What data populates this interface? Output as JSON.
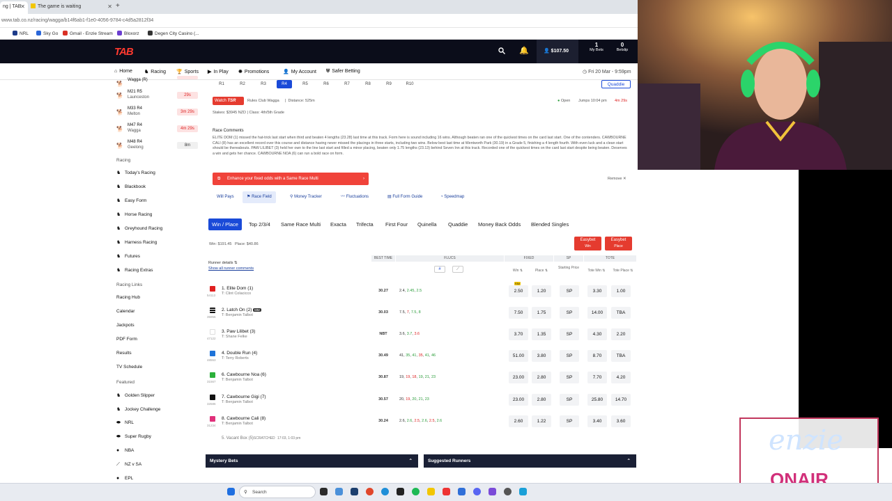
{
  "browser": {
    "tabs": [
      {
        "label": "ng | TAB",
        "active": true
      },
      {
        "label": "The game is waiting",
        "active": false
      }
    ],
    "new_tab": "+",
    "url": "www.tab.co.nz/racing/wagga/b14f6ab1-f1e0-4056-9784-c4d5a2812f34",
    "bookmarks": [
      "NRL",
      "Sky Go",
      "Gmail - Enzie Stream",
      "Bloxorz",
      "Degen City Casino (..."
    ]
  },
  "header": {
    "logo": "TAB",
    "balance": "$107.50",
    "my_bets_count": "1",
    "my_bets_label": "My Bets",
    "betslip_count": "0",
    "betslip_label": "Betslip"
  },
  "nav": {
    "items": [
      "Home",
      "Racing",
      "Sports",
      "In Play",
      "Promotions",
      "My Account",
      "Safer Betting"
    ],
    "datetime": "Fri 20 Mar - 9:59pm"
  },
  "sidebar": {
    "races": [
      {
        "code": "Wagga (R)",
        "venue": "",
        "time": ""
      },
      {
        "code": "M21 R5",
        "venue": "Launceston",
        "time": "29s"
      },
      {
        "code": "M33 R4",
        "venue": "Melton",
        "time": "3m 29s"
      },
      {
        "code": "M47 R4",
        "venue": "Wagga",
        "time": "4m 29s"
      },
      {
        "code": "M48 R4",
        "venue": "Geelong",
        "time": "8m"
      }
    ],
    "racing_title": "Racing",
    "racing_links": [
      "Today's Racing",
      "Blackbook",
      "Easy Form",
      "Horse Racing",
      "Greyhound Racing",
      "Harness Racing",
      "Futures",
      "Racing Extras"
    ],
    "racing_links_title": "Racing Links",
    "link_items": [
      "Racing Hub",
      "Calendar",
      "Jackpots",
      "PDF Form",
      "Results",
      "TV Schedule"
    ],
    "featured_title": "Featured",
    "featured": [
      "Golden Slipper",
      "Jockey Challenge",
      "NRL",
      "Super Rugby",
      "NBA",
      "NZ v SA",
      "EPL"
    ]
  },
  "race": {
    "race_buttons": [
      "R1",
      "R2",
      "R3",
      "R4",
      "R5",
      "R6",
      "R7",
      "R8",
      "R9",
      "R10"
    ],
    "selected_race": "R4",
    "quaddie": "Quaddie",
    "watch": "Watch",
    "watch_brand": "TSR",
    "club": "Rules Club Wagga",
    "distance": "Distance: 525m",
    "stakes": "Stakes: $3945 NZD  |  Class: 4th/5th Grade",
    "status": "Open",
    "jumps": "Jumps 10:04 pm",
    "countdown": "4m 29s",
    "comments_title": "Race Comments",
    "comments": "ELITE DOM (1) missed the hat-trick last start when third and beaten 4 lengths (23.28) last time at this track. Form here is sound including 16 wins. Although beaten ran one of the quickest times on the card last start. One of the contenders. CAWBOURNE CALI (8) has an excellent record over this course and distance having never missed the placings in three starts, including two wins. Below best last time at Wentworth Park (30.19) in a Grade 5, finishing a 4 length fourth. With even luck and a clean start should be thereabouts. PAW LILIBET (3) held her own to the line last start and filled a minor placing, beaten only 1.75 lengths (23.13) behind Seven Inn at this track. Recorded one of the quickest times on the card last start despite being beaten. Deserves a win and gets her chance. CAWBOURNE NOA (6) can run a bold race on form.",
    "promo": "Enhance your fixed odds with a Same Race Multi",
    "remove": "Remove",
    "tools": [
      "Will Pays",
      "Race Field",
      "Money Tracker",
      "Fluctuations",
      "Full Form Guide",
      "Speedmap"
    ],
    "bet_tabs": [
      "Win / Place",
      "Top 2/3/4",
      "Same Race Multi",
      "Exacta",
      "Trifecta",
      "First Four",
      "Quinella",
      "Quaddie",
      "Money Back Odds",
      "Blended Singles"
    ],
    "pool": "Win: $191.45   Place: $40.86",
    "easybet_win": [
      "Easybet",
      "Win"
    ],
    "easybet_place": [
      "Easybet",
      "Place"
    ]
  },
  "table": {
    "runner_details": "Runner details",
    "show_comments": "Show all runner comments",
    "best_time": "BEST TIME",
    "flucs": "FLUCS",
    "fixed": "FIXED",
    "sp": "SP",
    "tote": "TOTE",
    "col_win": "Win",
    "col_place": "Place",
    "col_sp": "Starting Price",
    "col_tote_win": "Tote Win",
    "col_tote_place": "Tote Place",
    "fav_badge": "FAV",
    "runners": [
      {
        "name": "1. Elite Dom (1)",
        "trainer": "T: Clint Colacicco",
        "id": "54113",
        "color": "#e02020",
        "best": "30.27",
        "flucs": [
          [
            "2.4",
            "n"
          ],
          [
            "2.45",
            "g"
          ],
          [
            "2.5",
            "g"
          ]
        ],
        "win": "2.50",
        "place": "1.20",
        "sp": "SP",
        "tote_win": "3.30",
        "tote_place": "1.00"
      },
      {
        "name": "2. Latch On (2)",
        "trainer": "T: Benjamin Talbot",
        "id": "35956",
        "color": "stripes",
        "best": "30.03",
        "flucs": [
          [
            "7.5",
            "n"
          ],
          [
            "7",
            "r"
          ],
          [
            "7.5",
            "g"
          ],
          [
            "8",
            "g"
          ]
        ],
        "win": "7.50",
        "place": "1.75",
        "sp": "SP",
        "tote_win": "14.00",
        "tote_place": "TBA",
        "badge": "MM"
      },
      {
        "name": "3. Paw Lilibet (3)",
        "trainer": "T: Shane Felke",
        "id": "47122",
        "color": "#ffffff",
        "best": "NBT",
        "flucs": [
          [
            "3.6",
            "n"
          ],
          [
            "3.7",
            "g"
          ],
          [
            "3.6",
            "r"
          ]
        ],
        "win": "3.70",
        "place": "1.35",
        "sp": "SP",
        "tote_win": "4.30",
        "tote_place": "2.20"
      },
      {
        "name": "4. Double Run (4)",
        "trainer": "T: Terry Roberts",
        "id": "48553",
        "color": "#1e73d9",
        "best": "30.49",
        "flucs": [
          [
            "41",
            "n"
          ],
          [
            "35",
            "g"
          ],
          [
            "41",
            "g"
          ],
          [
            "35",
            "r"
          ],
          [
            "41",
            "g"
          ],
          [
            "46",
            "g"
          ]
        ],
        "win": "51.00",
        "place": "3.80",
        "sp": "SP",
        "tote_win": "8.70",
        "tote_place": "TBA"
      },
      {
        "name": "6. Cawbourne Noa (6)",
        "trainer": "T: Benjamin Talbot",
        "id": "31567",
        "color": "#2bb03a",
        "best": "30.87",
        "flucs": [
          [
            "19",
            "n"
          ],
          [
            "19",
            "r"
          ],
          [
            "18",
            "r"
          ],
          [
            "19",
            "g"
          ],
          [
            "21",
            "g"
          ],
          [
            "23",
            "g"
          ]
        ],
        "win": "23.00",
        "place": "2.80",
        "sp": "SP",
        "tote_win": "7.70",
        "tote_place": "4.20"
      },
      {
        "name": "7. Cawbourne Gigi (7)",
        "trainer": "T: Benjamin Talbot",
        "id": "32586",
        "color": "#111111",
        "best": "30.57",
        "flucs": [
          [
            "20",
            "n"
          ],
          [
            "19",
            "r"
          ],
          [
            "20",
            "g"
          ],
          [
            "21",
            "g"
          ],
          [
            "23",
            "g"
          ]
        ],
        "win": "23.00",
        "place": "2.80",
        "sp": "SP",
        "tote_win": "25.80",
        "tote_place": "14.70"
      },
      {
        "name": "8. Cawbourne Cali (8)",
        "trainer": "T: Benjamin Talbot",
        "id": "31234",
        "color": "#e0307a",
        "best": "30.24",
        "flucs": [
          [
            "2.6",
            "n"
          ],
          [
            "2.6",
            "g"
          ],
          [
            "2.5",
            "r"
          ],
          [
            "2.6",
            "g"
          ],
          [
            "2.5",
            "r"
          ],
          [
            "2.6",
            "g"
          ]
        ],
        "win": "2.60",
        "place": "1.22",
        "sp": "SP",
        "tote_win": "3.40",
        "tote_place": "3.60"
      }
    ],
    "scratched": "5. Vacant Box (5)",
    "scratched_label": "SCRATCHED",
    "scratched_time": "17:03, 1:03 pm"
  },
  "panels": {
    "mystery": "Mystery Bets",
    "suggested": "Suggested Runners"
  },
  "overlay": {
    "brand_top": "enzie",
    "brand_bottom": "ONAIR"
  },
  "taskbar": {
    "search": "Search"
  }
}
